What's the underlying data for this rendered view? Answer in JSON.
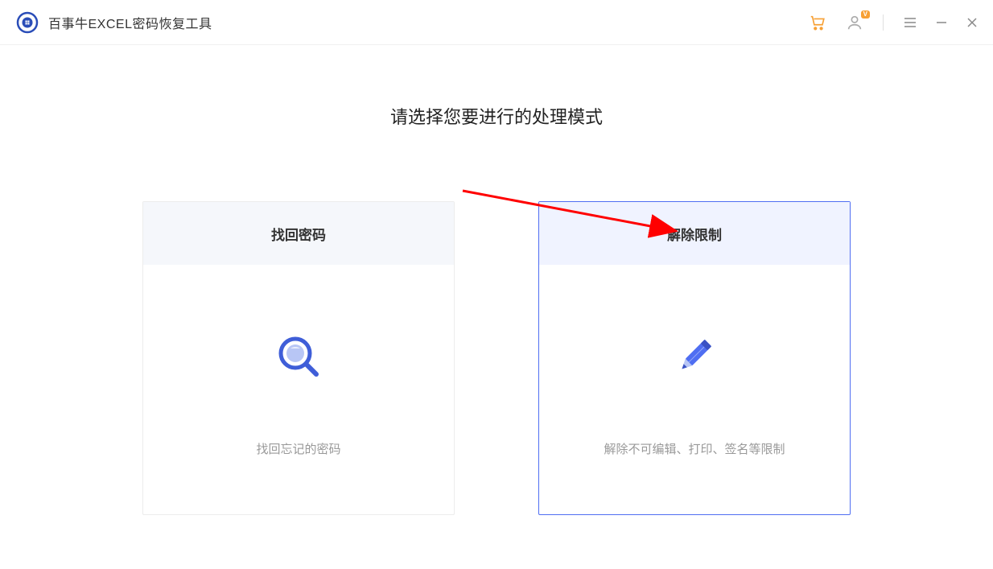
{
  "app": {
    "title": "百事牛EXCEL密码恢复工具",
    "vip_badge": "V"
  },
  "page": {
    "heading": "请选择您要进行的处理模式"
  },
  "cards": {
    "recover": {
      "title": "找回密码",
      "desc": "找回忘记的密码"
    },
    "remove": {
      "title": "解除限制",
      "desc": "解除不可编辑、打印、签名等限制"
    }
  },
  "colors": {
    "accent_orange": "#f7a035",
    "accent_blue": "#4f6ef2",
    "icon_blue": "#3f5ed8"
  }
}
